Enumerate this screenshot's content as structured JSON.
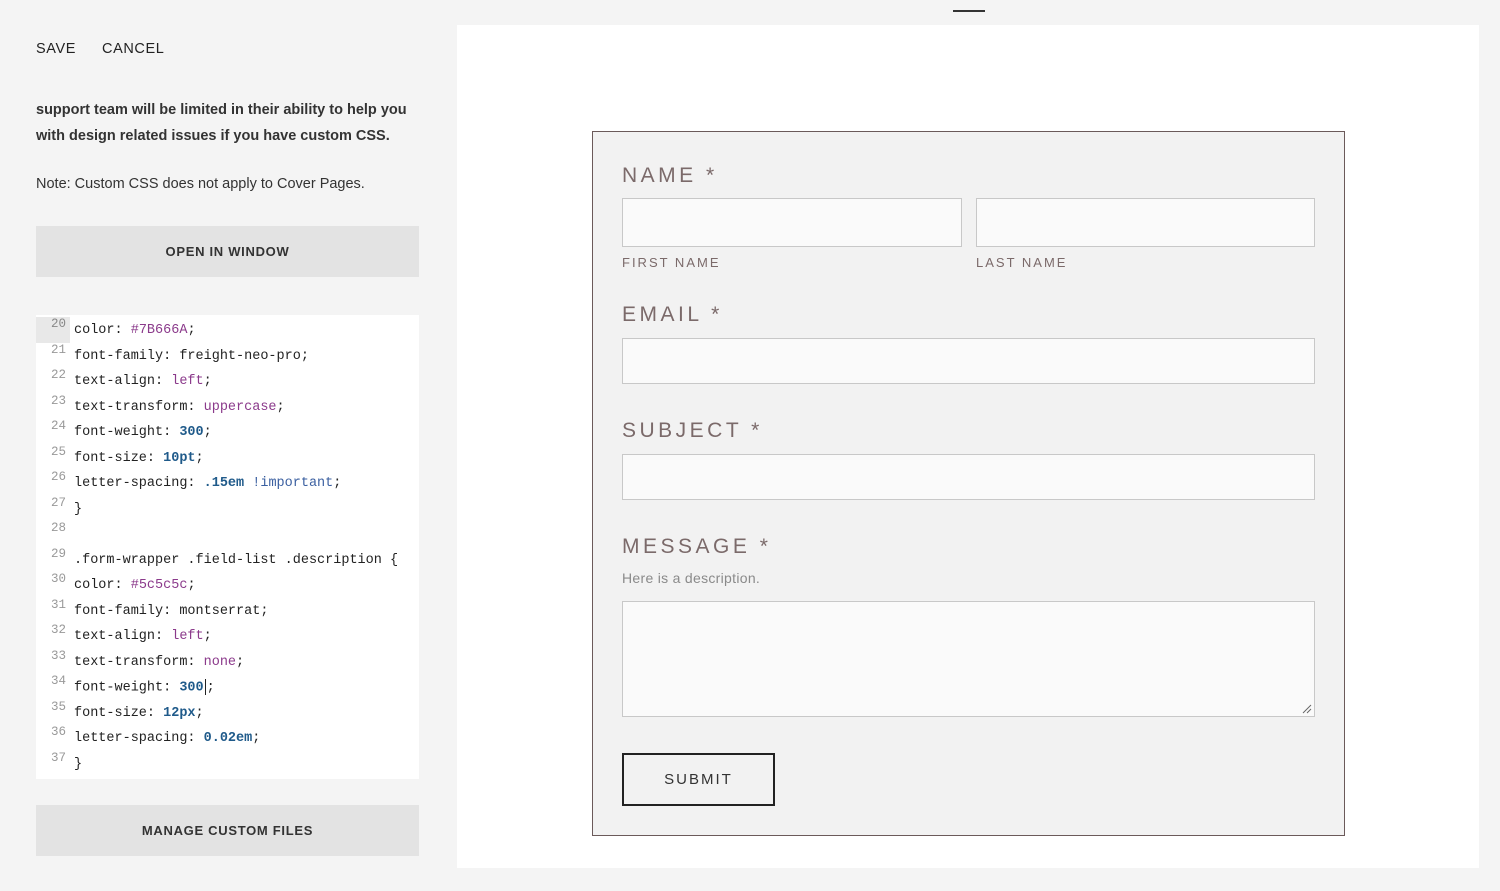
{
  "toolbar": {
    "save_label": "SAVE",
    "cancel_label": "CANCEL"
  },
  "panel": {
    "warning": "support team will be limited in their ability to help you with design related issues if you have custom CSS.",
    "note": "Note: Custom CSS does not apply to Cover Pages.",
    "open_window_label": "OPEN IN WINDOW",
    "manage_files_label": "MANAGE CUSTOM FILES"
  },
  "editor": {
    "active_line": 20,
    "lines": [
      {
        "n": "20",
        "parts": [
          [
            "color: ",
            ""
          ],
          [
            "#7B666A",
            "c-str"
          ],
          [
            ";",
            ""
          ]
        ]
      },
      {
        "n": "21",
        "parts": [
          [
            "font-family: freight-neo-pro;",
            ""
          ]
        ]
      },
      {
        "n": "22",
        "parts": [
          [
            "text-align: ",
            ""
          ],
          [
            "left",
            "c-str"
          ],
          [
            ";",
            ""
          ]
        ]
      },
      {
        "n": "23",
        "parts": [
          [
            "text-transform: ",
            ""
          ],
          [
            "uppercase",
            "c-str"
          ],
          [
            ";",
            ""
          ]
        ]
      },
      {
        "n": "24",
        "parts": [
          [
            "font-weight: ",
            ""
          ],
          [
            "300",
            "c-num"
          ],
          [
            ";",
            ""
          ]
        ]
      },
      {
        "n": "25",
        "parts": [
          [
            "font-size: ",
            ""
          ],
          [
            "10pt",
            "c-num"
          ],
          [
            ";",
            ""
          ]
        ]
      },
      {
        "n": "26",
        "parts": [
          [
            "letter-spacing: ",
            ""
          ],
          [
            ".15em",
            "c-num"
          ],
          [
            " ",
            ""
          ],
          [
            "!important",
            "c-kw"
          ],
          [
            ";",
            ""
          ]
        ]
      },
      {
        "n": "27",
        "parts": [
          [
            "}",
            ""
          ]
        ]
      },
      {
        "n": "28",
        "parts": [
          [
            "",
            ""
          ]
        ]
      },
      {
        "n": "29",
        "parts": [
          [
            ".form-wrapper .field-list .description {",
            ""
          ]
        ]
      },
      {
        "n": "30",
        "parts": [
          [
            "color: ",
            ""
          ],
          [
            "#5c5c5c",
            "c-str"
          ],
          [
            ";",
            ""
          ]
        ]
      },
      {
        "n": "31",
        "parts": [
          [
            "font-family: montserrat;",
            ""
          ]
        ]
      },
      {
        "n": "32",
        "parts": [
          [
            "text-align: ",
            ""
          ],
          [
            "left",
            "c-str"
          ],
          [
            ";",
            ""
          ]
        ]
      },
      {
        "n": "33",
        "parts": [
          [
            "text-transform: ",
            ""
          ],
          [
            "none",
            "c-str"
          ],
          [
            ";",
            ""
          ]
        ]
      },
      {
        "n": "34",
        "parts": [
          [
            "font-weight: ",
            ""
          ],
          [
            "300",
            "c-num"
          ],
          [
            "|CURSOR|",
            ""
          ],
          [
            ";",
            ""
          ]
        ]
      },
      {
        "n": "35",
        "parts": [
          [
            "font-size: ",
            ""
          ],
          [
            "12px",
            "c-num"
          ],
          [
            ";",
            ""
          ]
        ]
      },
      {
        "n": "36",
        "parts": [
          [
            "letter-spacing: ",
            ""
          ],
          [
            "0.02em",
            "c-num"
          ],
          [
            ";",
            ""
          ]
        ]
      },
      {
        "n": "37",
        "parts": [
          [
            "}",
            ""
          ]
        ]
      }
    ]
  },
  "form": {
    "name_label": "NAME *",
    "first_name_label": "FIRST NAME",
    "last_name_label": "LAST NAME",
    "email_label": "EMAIL *",
    "subject_label": "SUBJECT *",
    "message_label": "MESSAGE *",
    "message_description": "Here is a description.",
    "submit_label": "SUBMIT"
  },
  "colors": {
    "label_color": "#7B666A",
    "description_color": "#5c5c5c"
  }
}
